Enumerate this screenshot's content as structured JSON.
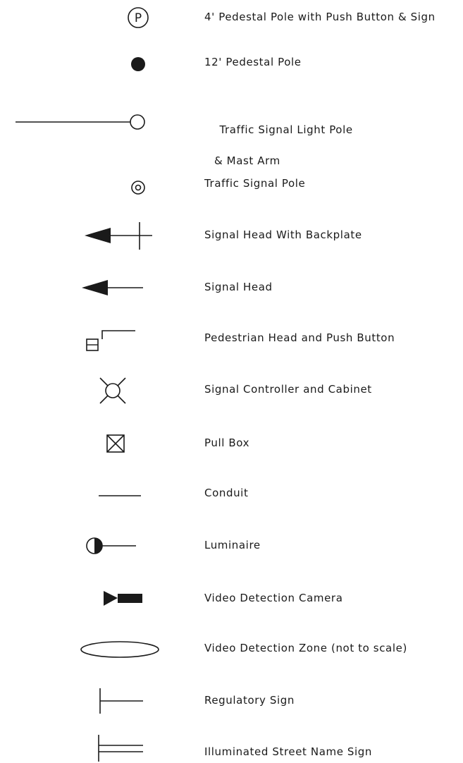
{
  "legend": {
    "ink_color": "#1a1a1a",
    "items": [
      {
        "symbol": "pedestal-pole-push-button-icon",
        "label": "4' Pedestal Pole with Push Button & Sign"
      },
      {
        "symbol": "filled-circle-pedestal-pole-icon",
        "label": "12' Pedestal Pole"
      },
      {
        "symbol": "pole-with-mast-arm-icon",
        "label": "Traffic Signal Light Pole",
        "label2": "& Mast Arm"
      },
      {
        "symbol": "double-circle-pole-icon",
        "label": "Traffic Signal Pole"
      },
      {
        "symbol": "signal-head-backplate-icon",
        "label": "Signal Head With Backplate"
      },
      {
        "symbol": "signal-head-arrow-icon",
        "label": "Signal Head"
      },
      {
        "symbol": "pedestrian-head-push-button-icon",
        "label": "Pedestrian Head and Push Button"
      },
      {
        "symbol": "signal-controller-cabinet-icon",
        "label": "Signal Controller and Cabinet"
      },
      {
        "symbol": "pull-box-icon",
        "label": "Pull Box"
      },
      {
        "symbol": "conduit-line-icon",
        "label": "Conduit"
      },
      {
        "symbol": "luminaire-half-circle-icon",
        "label": "Luminaire"
      },
      {
        "symbol": "video-camera-icon",
        "label": "Video Detection Camera"
      },
      {
        "symbol": "detection-zone-ellipse-icon",
        "label": "Video Detection Zone (not to scale)"
      },
      {
        "symbol": "regulatory-sign-icon",
        "label": "Regulatory Sign"
      },
      {
        "symbol": "street-name-sign-icon",
        "label": "Illuminated Street Name Sign"
      }
    ]
  }
}
